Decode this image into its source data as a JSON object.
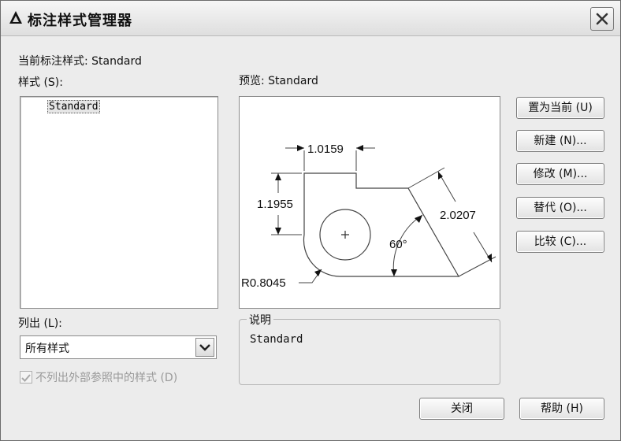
{
  "window": {
    "title": "标注样式管理器",
    "icon": "autocad-a-icon"
  },
  "current_style": {
    "label": "当前标注样式: Standard"
  },
  "styles_section": {
    "label": "样式 (S):",
    "items": [
      "Standard"
    ],
    "selected": "Standard"
  },
  "preview": {
    "label": "预览: Standard",
    "dimensions": {
      "top_width": "1.0159",
      "left_height": "1.1955",
      "diagonal": "2.0207",
      "angle": "60°",
      "radius": "R0.8045"
    }
  },
  "list_section": {
    "label": "列出 (L):",
    "selected_option": "所有样式"
  },
  "exclude_xref": {
    "label": "不列出外部参照中的样式 (D)",
    "checked": true,
    "enabled": false
  },
  "description": {
    "legend": "说明",
    "text": "Standard"
  },
  "buttons": {
    "set_current": "置为当前 (U)",
    "new": "新建 (N)...",
    "modify": "修改 (M)...",
    "override": "替代 (O)...",
    "compare": "比较 (C)...",
    "close": "关闭",
    "help": "帮助 (H)"
  }
}
